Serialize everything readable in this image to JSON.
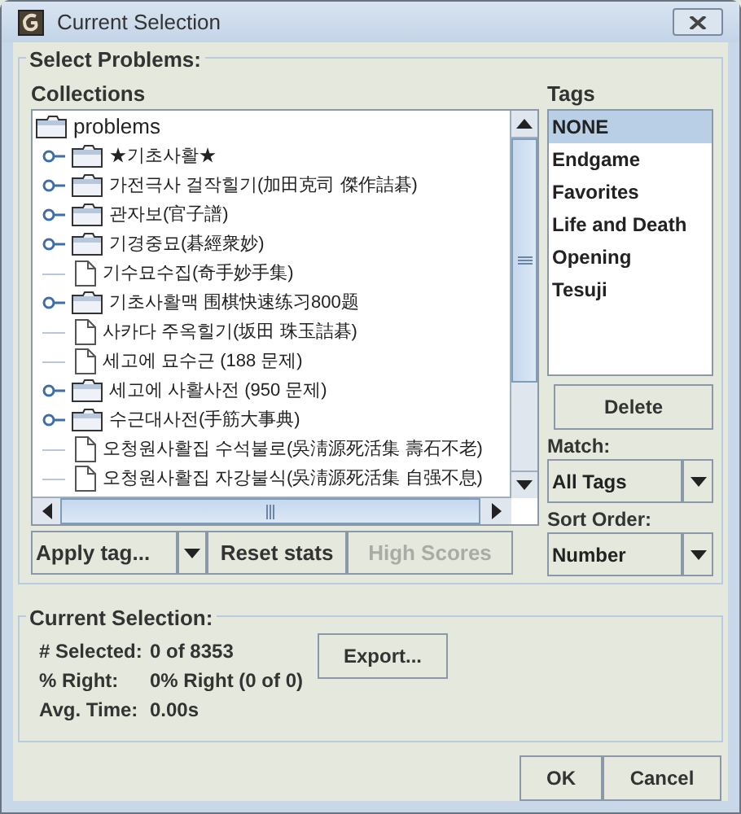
{
  "window": {
    "title": "Current Selection"
  },
  "select_problems": {
    "title": "Select Problems:",
    "collections_label": "Collections",
    "tree": {
      "label": "problems",
      "children": [
        {
          "label": "★기초사활★",
          "kind": "folder",
          "expanded": false
        },
        {
          "label": "가전극사 걸작힐기(加田克司 傑作詰碁)",
          "kind": "folder",
          "expanded": false
        },
        {
          "label": "관자보(官子譜)",
          "kind": "folder",
          "expanded": false
        },
        {
          "label": "기경중묘(碁經衆妙)",
          "kind": "folder",
          "expanded": false
        },
        {
          "label": "기수묘수집(奇手妙手集)",
          "kind": "file"
        },
        {
          "label": "기초사활맥 围棋快速练习800题",
          "kind": "folder",
          "expanded": false
        },
        {
          "label": "사카다 주옥힐기(坂田 珠玉詰碁)",
          "kind": "file"
        },
        {
          "label": "세고에 묘수근 (188 문제)",
          "kind": "file"
        },
        {
          "label": "세고에 사활사전 (950 문제)",
          "kind": "folder",
          "expanded": false
        },
        {
          "label": "수근대사전(手筋大事典)",
          "kind": "folder",
          "expanded": false
        },
        {
          "label": "오청원사활집 수석불로(吳淸源死活集 壽石不老)",
          "kind": "file"
        },
        {
          "label": "오청원사활집 자강불식(吳淸源死活集 自强不息)",
          "kind": "file"
        }
      ]
    },
    "tags_label": "Tags",
    "tags": [
      {
        "label": "NONE",
        "selected": true
      },
      {
        "label": "Endgame",
        "selected": false
      },
      {
        "label": "Favorites",
        "selected": false
      },
      {
        "label": "Life and Death",
        "selected": false
      },
      {
        "label": "Opening",
        "selected": false
      },
      {
        "label": "Tesuji",
        "selected": false
      }
    ],
    "delete_button": "Delete",
    "match_label": "Match:",
    "match_value": "All Tags",
    "sort_label": "Sort Order:",
    "sort_value": "Number",
    "buttons": [
      {
        "label": "Apply tag...",
        "kind": "dropdown",
        "disabled": false
      },
      {
        "label": "Reset stats",
        "kind": "button",
        "disabled": false
      },
      {
        "label": "High Scores",
        "kind": "button",
        "disabled": true
      }
    ]
  },
  "current_selection": {
    "title": "Current Selection:",
    "stats": [
      {
        "label": "# Selected:",
        "value": "0 of 8353"
      },
      {
        "label": "% Right:",
        "value": "0% Right (0 of 0)"
      },
      {
        "label": "Avg. Time:",
        "value": "0.00s"
      }
    ],
    "export_button": "Export..."
  },
  "dialog_buttons": [
    "OK",
    "Cancel"
  ]
}
